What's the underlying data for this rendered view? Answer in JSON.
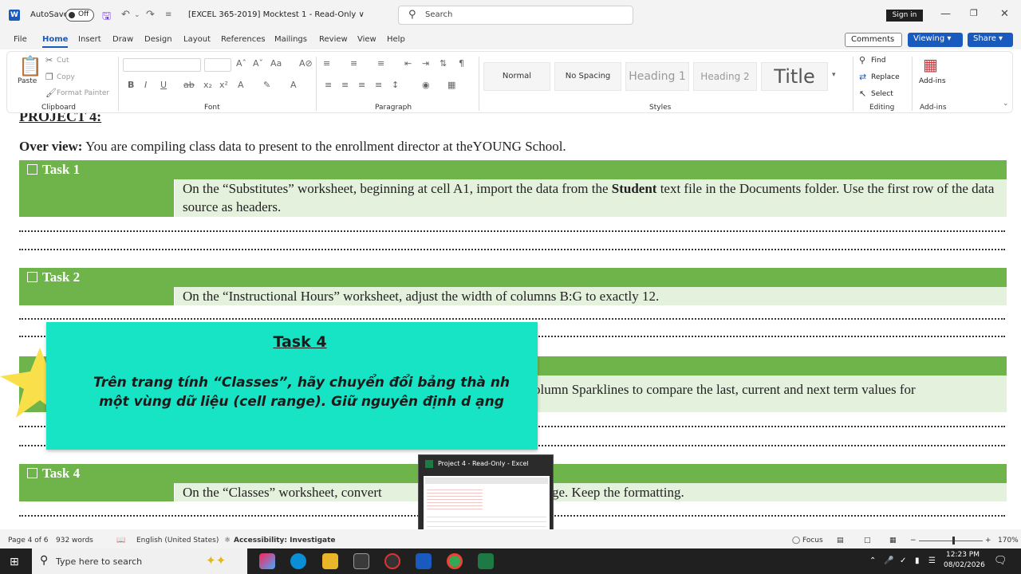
{
  "titlebar": {
    "autosave_label": "AutoSave",
    "autosave_state": "Off",
    "doc_title": "[EXCEL 365-2019] Mocktest 1  -  Read-Only ∨",
    "search_placeholder": "Search",
    "signin": "Sign in"
  },
  "menu": {
    "tabs": [
      "File",
      "Home",
      "Insert",
      "Draw",
      "Design",
      "Layout",
      "References",
      "Mailings",
      "Review",
      "View",
      "Help"
    ],
    "comments": "Comments",
    "viewing": "Viewing ▾",
    "share": "Share ▾"
  },
  "ribbon": {
    "clipboard": {
      "paste": "Paste",
      "cut": "Cut",
      "copy": "Copy",
      "format_painter": "Format Painter",
      "label": "Clipboard"
    },
    "font_label": "Font",
    "paragraph_label": "Paragraph",
    "styles": [
      "Normal",
      "No Spacing",
      "Heading 1",
      "Heading 2",
      "Title"
    ],
    "styles_label": "Styles",
    "editing": {
      "find": "Find",
      "replace": "Replace",
      "select": "Select",
      "label": "Editing"
    },
    "addins": {
      "button": "Add-ins",
      "label": "Add-ins"
    }
  },
  "document": {
    "project_heading": "PROJECT 4:",
    "overview_label": "Over view:",
    "overview_text": " You are compiling class data to present to the enrollment director at theYOUNG School.",
    "tasks": [
      {
        "title": "Task 1",
        "body_pre": "On the “Substitutes” worksheet, beginning at cell A1, import the data from the ",
        "body_bold": "Student",
        "body_post": " text file in the Documents folder. Use the first row of the data source as headers."
      },
      {
        "title": "Task 2",
        "body": "On the “Instructional Hours” worksheet, adjust the width of columns B:G to exactly 12."
      },
      {
        "title": "",
        "body": "olumn Sparklines to compare the last, current and next term values for"
      },
      {
        "title": "Task 4",
        "body": "On the “Classes” worksheet, convert",
        "body_tail": "ge. Keep the formatting."
      }
    ]
  },
  "overlay": {
    "title": "Task 4",
    "body": "Trên trang tính “Classes”, hãy chuyển đổi bảng thà nh một vùng dữ liệu (cell range). Giữ nguyên định d ạng",
    "color": "#17e3c5"
  },
  "preview": {
    "title": "Project 4  -  Read-Only - Excel"
  },
  "statusbar": {
    "page": "Page 4 of 6",
    "words": "932 words",
    "language": "English (United States)",
    "accessibility": "Accessibility: Investigate",
    "focus": "Focus",
    "zoom": "170%"
  },
  "taskbar": {
    "search_placeholder": "Type here to search",
    "time": "12:23 PM",
    "date": "08/02/2026"
  },
  "colors": {
    "accent": "#185abd",
    "task_green": "#6fb44a",
    "task_light": "#e4f1dc"
  }
}
